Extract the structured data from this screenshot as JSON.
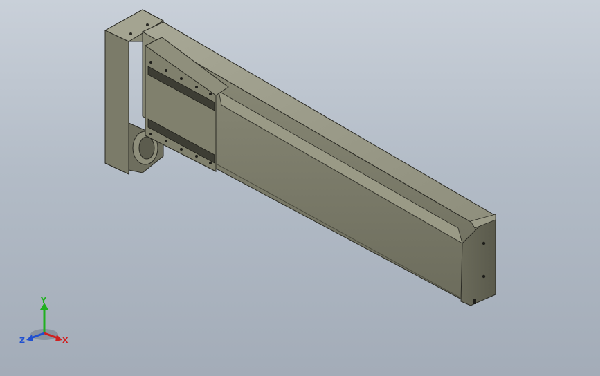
{
  "viewport": {
    "background_top": "#c9d0d9",
    "background_bottom": "#a3acb8"
  },
  "model": {
    "body_color": "#7f7f6d",
    "body_dark": "#55554a",
    "body_light": "#a6a693",
    "edge_color": "#2a2a24"
  },
  "triad": {
    "x_label": "X",
    "y_label": "Y",
    "z_label": "Z",
    "x_color": "#d02020",
    "y_color": "#20b020",
    "z_color": "#2050d0"
  }
}
